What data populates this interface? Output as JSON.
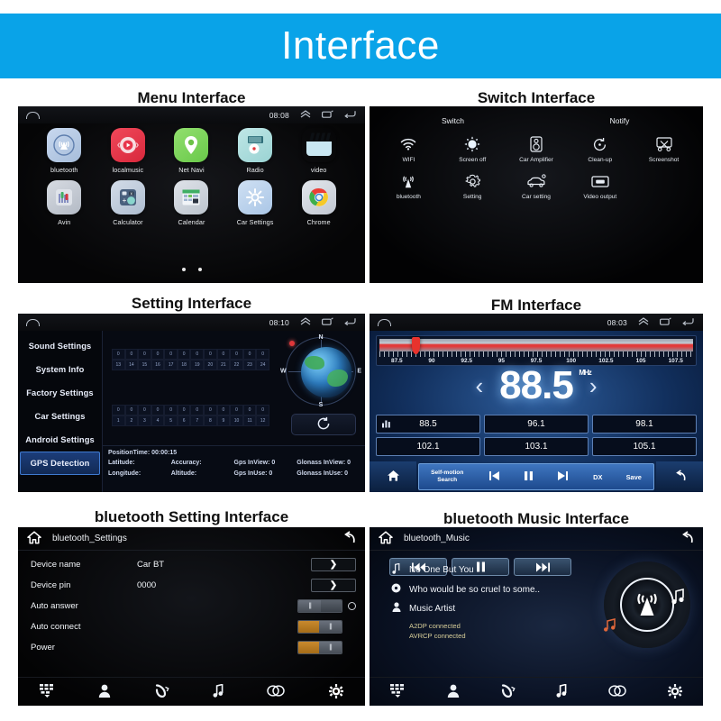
{
  "banner": {
    "title": "Interface",
    "bg": "#09a3e8"
  },
  "sections": [
    {
      "caption": "Menu Interface"
    },
    {
      "caption": "Switch Interface"
    },
    {
      "caption": "Setting Interface"
    },
    {
      "caption": "FM Interface"
    },
    {
      "caption": "bluetooth Setting Interface"
    },
    {
      "caption": "bluetooth Music Interface"
    }
  ],
  "menu": {
    "statusbar": {
      "clock": "08:08",
      "home_icon": "home-icon",
      "up_icon": "chevron-up-icon",
      "recents_icon": "recents-icon",
      "back_icon": "back-icon"
    },
    "apps_row1": [
      {
        "label": "bluetooth",
        "icon": "bluetooth-signal-icon"
      },
      {
        "label": "localmusic",
        "icon": "play-circle-icon"
      },
      {
        "label": "Net Navi",
        "icon": "map-pin-icon"
      },
      {
        "label": "Radio",
        "icon": "radio-icon"
      },
      {
        "label": "video",
        "icon": "clapperboard-icon"
      }
    ],
    "apps_row2": [
      {
        "label": "Avin",
        "icon": "avin-icon"
      },
      {
        "label": "Calculator",
        "icon": "calculator-icon"
      },
      {
        "label": "Calendar",
        "icon": "calendar-icon"
      },
      {
        "label": "Car Settings",
        "icon": "gear-icon"
      },
      {
        "label": "Chrome",
        "icon": "chrome-icon"
      }
    ],
    "page_dots": 2
  },
  "switch": {
    "headers": [
      "Switch",
      "Notify"
    ],
    "row1": [
      {
        "label": "WIFI",
        "icon": "wifi-icon",
        "glyph": "📶"
      },
      {
        "label": "Screen off",
        "icon": "brightness-icon",
        "glyph": "☀"
      },
      {
        "label": "Car Amplifier",
        "icon": "speaker-icon",
        "glyph": "🔊"
      },
      {
        "label": "Clean-up",
        "icon": "cleanup-refresh-icon",
        "glyph": "↻"
      },
      {
        "label": "Screenshot",
        "icon": "screenshot-icon",
        "glyph": "✂"
      }
    ],
    "row2": [
      {
        "label": "bluetooth",
        "icon": "bluetooth-antenna-icon",
        "glyph": "((▲))"
      },
      {
        "label": "Setting",
        "icon": "gear-icon",
        "glyph": "⚙"
      },
      {
        "label": "Car setting",
        "icon": "car-icon",
        "glyph": "🚗"
      },
      {
        "label": "Video output",
        "icon": "video-output-icon",
        "glyph": "▭"
      }
    ]
  },
  "setting": {
    "statusbar": {
      "clock": "08:10"
    },
    "sidebar": [
      {
        "label": "Sound Settings",
        "active": false
      },
      {
        "label": "System Info",
        "active": false
      },
      {
        "label": "Factory Settings",
        "active": false
      },
      {
        "label": "Car Settings",
        "active": false
      },
      {
        "label": "Android Settings",
        "active": false
      },
      {
        "label": "GPS Detection",
        "active": true
      }
    ],
    "sat_top_values": [
      "0",
      "0",
      "0",
      "0",
      "0",
      "0",
      "0",
      "0",
      "0",
      "0",
      "0",
      "0"
    ],
    "sat_top_ids": [
      "13",
      "14",
      "15",
      "16",
      "17",
      "18",
      "19",
      "20",
      "21",
      "22",
      "23",
      "24"
    ],
    "sat_bot_values": [
      "0",
      "0",
      "0",
      "0",
      "0",
      "0",
      "0",
      "0",
      "0",
      "0",
      "0",
      "0"
    ],
    "sat_bot_ids": [
      "1",
      "2",
      "3",
      "4",
      "5",
      "6",
      "7",
      "8",
      "9",
      "10",
      "11",
      "12"
    ],
    "compass": {
      "n": "N",
      "s": "S",
      "e": "E",
      "w": "W"
    },
    "refresh_icon": "refresh-icon",
    "footer": {
      "position_time": "PositionTime: 00:00:15",
      "fields": [
        "Latitude:",
        "Accuracy:",
        "Gps InView: 0",
        "Glonass InView: 0",
        "Longitude:",
        "Altitude:",
        "Gps InUse: 0",
        "Glonass InUse: 0"
      ]
    }
  },
  "fm": {
    "statusbar": {
      "clock": "08:03"
    },
    "scale": [
      "87.5",
      "90",
      "92.5",
      "95",
      "97.5",
      "100",
      "102.5",
      "105",
      "107.5"
    ],
    "cursor_percent": 11,
    "frequency": "88.5",
    "unit": "MHz",
    "prev_icon": "chevron-left-icon",
    "next_icon": "chevron-right-icon",
    "presets_row1": [
      "88.5",
      "96.1",
      "98.1"
    ],
    "presets_row2": [
      "102.1",
      "103.1",
      "105.1"
    ],
    "preset_eq_icon": "equalizer-icon",
    "bottom": {
      "home_icon": "home-icon",
      "search_label": "Self-motion\nSearch",
      "search_label_l1": "Self-motion",
      "search_label_l2": "Search",
      "prev_icon": "⏮",
      "pause_icon": "▐▐",
      "next_icon": "⏭",
      "dx_label": "DX",
      "save_label": "Save",
      "back_icon": "back-icon"
    }
  },
  "bt_settings": {
    "title": "bluetooth_Settings",
    "home_icon": "home-icon",
    "back_icon": "back-icon",
    "rows": [
      {
        "label": "Device name",
        "value": "Car BT",
        "control": "arrow"
      },
      {
        "label": "Device pin",
        "value": "0000",
        "control": "arrow"
      },
      {
        "label": "Auto answer",
        "value": "",
        "control": "toggle-off"
      },
      {
        "label": "Auto connect",
        "value": "",
        "control": "toggle-on"
      },
      {
        "label": "Power",
        "value": "",
        "control": "toggle-on"
      }
    ],
    "arrow_glyph": "❯",
    "nav": [
      {
        "icon": "dialpad-icon",
        "glyph": "☷",
        "active": false
      },
      {
        "icon": "contacts-icon",
        "glyph": "👤",
        "active": false
      },
      {
        "icon": "call-log-icon",
        "glyph": "☎",
        "active": false
      },
      {
        "icon": "music-note-icon",
        "glyph": "♪",
        "active": false
      },
      {
        "icon": "link-rings-icon",
        "glyph": "⚭",
        "active": false
      },
      {
        "icon": "gear-icon",
        "glyph": "⚙",
        "active": true
      }
    ]
  },
  "bt_music": {
    "title": "bluetooth_Music",
    "home_icon": "home-icon",
    "back_icon": "back-icon",
    "controls": [
      {
        "icon": "prev-track-icon",
        "glyph": "⏮"
      },
      {
        "icon": "pause-icon",
        "glyph": "▐▐"
      },
      {
        "icon": "next-track-icon",
        "glyph": "⏭"
      }
    ],
    "track_title": "No One But You",
    "album": "Who would be so cruel to some..",
    "artist": "Music Artist",
    "track_icon": "music-note-icon",
    "album_icon": "disc-icon",
    "artist_icon": "person-icon",
    "status": [
      "A2DP connected",
      "AVRCP connected"
    ],
    "nav": [
      {
        "icon": "dialpad-icon",
        "glyph": "☷",
        "active": false
      },
      {
        "icon": "contacts-icon",
        "glyph": "👤",
        "active": false
      },
      {
        "icon": "call-log-icon",
        "glyph": "☎",
        "active": false
      },
      {
        "icon": "music-note-icon",
        "glyph": "♪",
        "active": true
      },
      {
        "icon": "link-rings-icon",
        "glyph": "⚭",
        "active": false
      },
      {
        "icon": "gear-icon",
        "glyph": "⚙",
        "active": false
      }
    ]
  }
}
